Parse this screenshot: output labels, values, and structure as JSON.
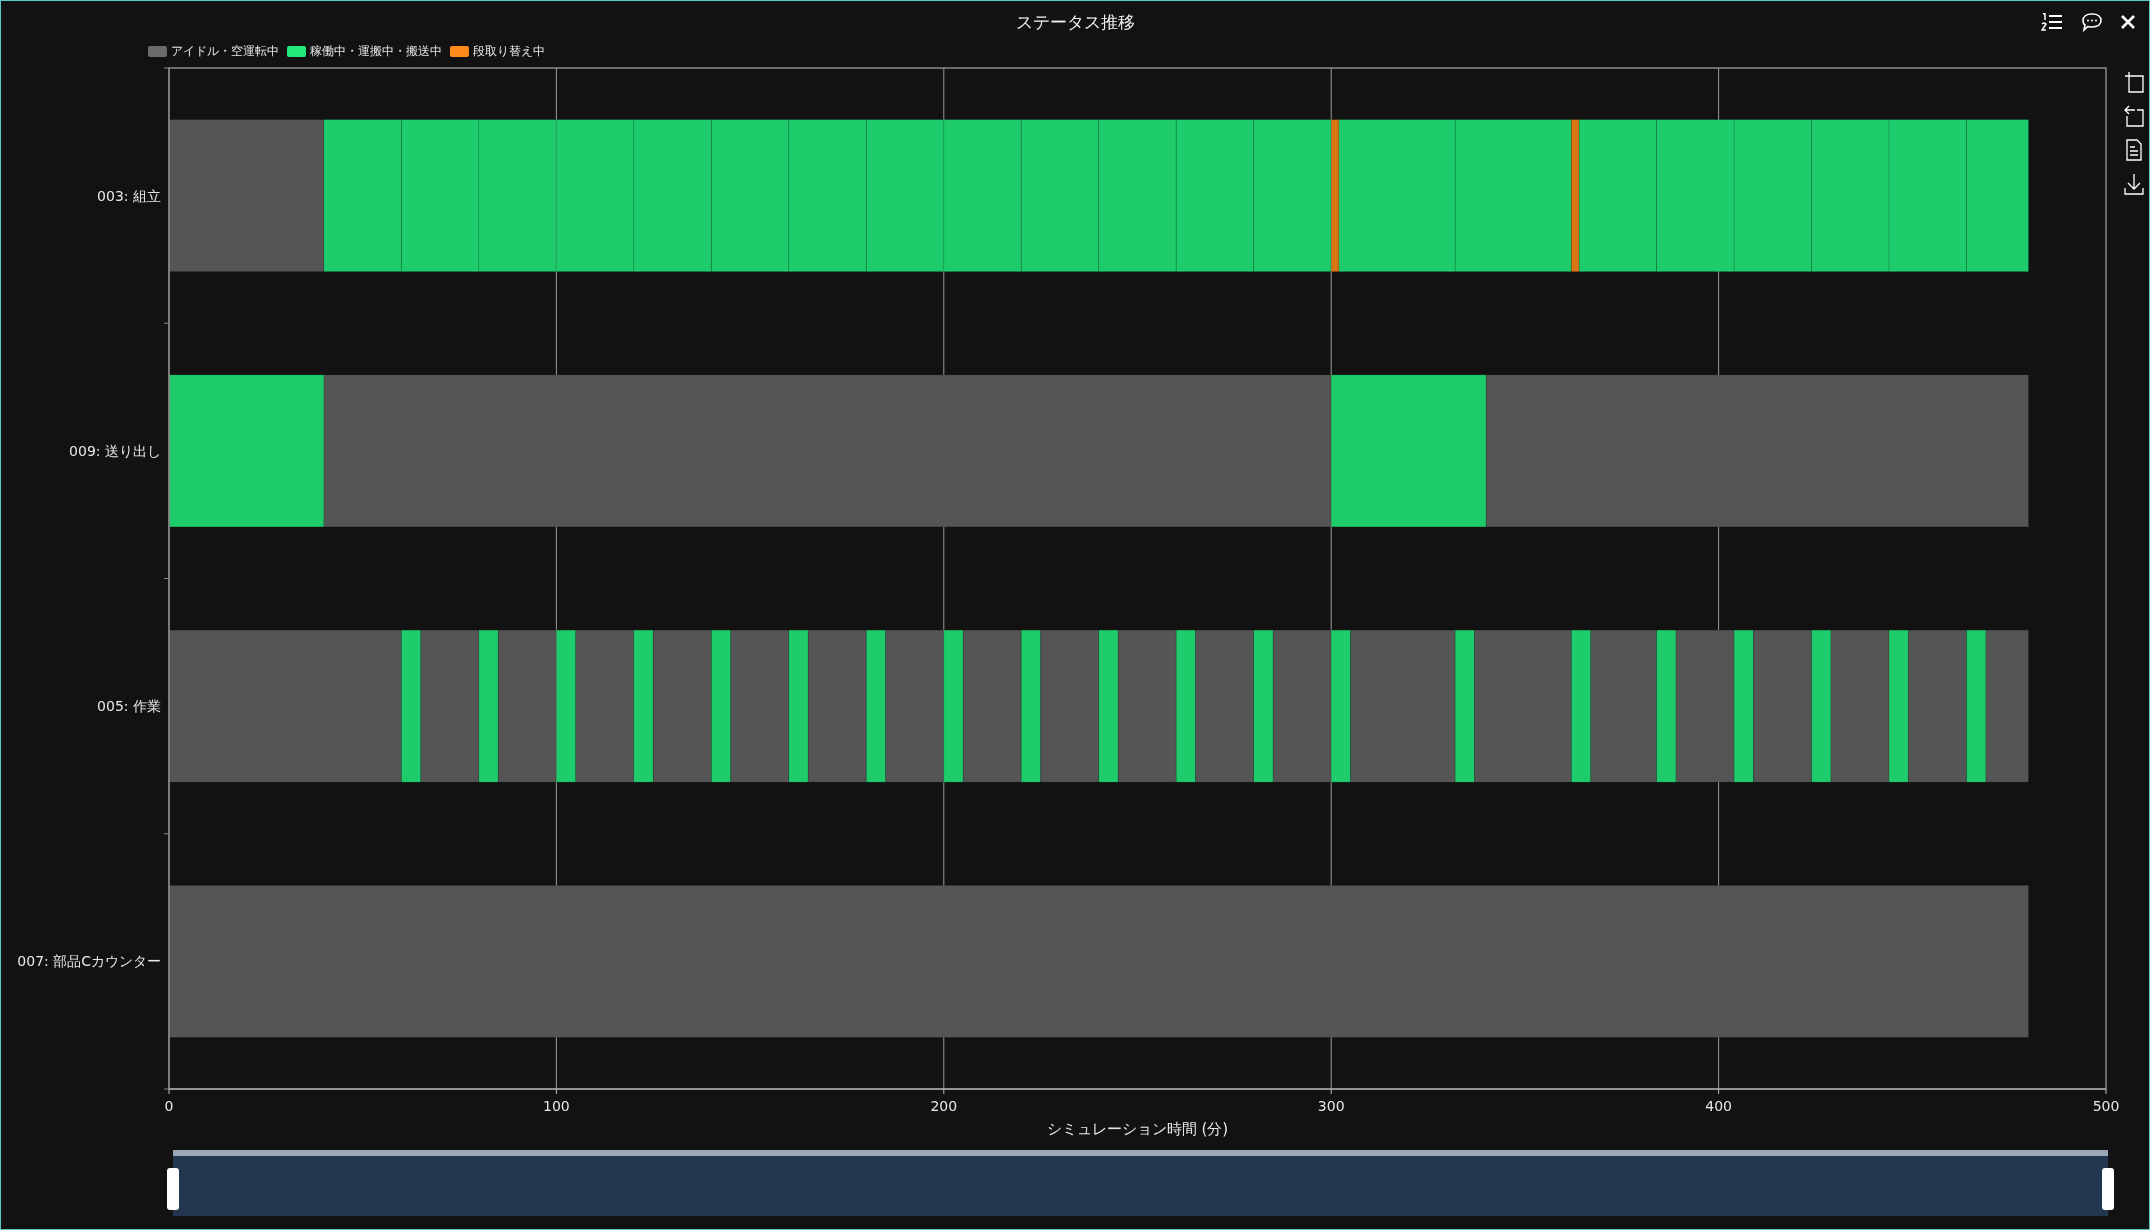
{
  "window": {
    "title": "ステータス推移"
  },
  "chart": {
    "legend": [
      {
        "label": "アイドル・空運転中",
        "color": "#6b6b6b"
      },
      {
        "label": "稼働中・運搬中・搬送中",
        "color": "#25e87a"
      },
      {
        "label": "段取り替え中",
        "color": "#ff8c1a"
      }
    ],
    "chart_data": {
      "type": "bar",
      "orientation": "horizontal",
      "stacked": true,
      "grid": true,
      "xlabel": "シミュレーション時間 (分)",
      "categories": [
        "003: 組立",
        "009: 送り出し",
        "005: 作業",
        "007: 部品Cカウンター"
      ],
      "xlim": [
        0,
        500
      ],
      "xticks": [
        0,
        100,
        200,
        300,
        400,
        500
      ],
      "series": [
        {
          "color": "#555555",
          "values": [
            40,
            null,
            60,
            480
          ]
        },
        {
          "color": "#1ecc6c",
          "values": [
            20,
            40,
            5,
            null
          ]
        },
        {
          "color": "#555555",
          "values": [
            null,
            260,
            15,
            null
          ]
        },
        {
          "color": "#1ecc6c",
          "values": [
            20,
            40,
            5,
            null
          ]
        },
        {
          "color": "#555555",
          "values": [
            null,
            140,
            15,
            null
          ]
        },
        {
          "color": "#1ecc6c",
          "values": [
            20,
            null,
            5,
            null
          ]
        },
        {
          "color": "#555555",
          "values": [
            null,
            null,
            15,
            null
          ]
        },
        {
          "color": "#1ecc6c",
          "values": [
            20,
            null,
            5,
            null
          ]
        },
        {
          "color": "#555555",
          "values": [
            null,
            null,
            15,
            null
          ]
        },
        {
          "color": "#1ecc6c",
          "values": [
            20,
            null,
            5,
            null
          ]
        },
        {
          "color": "#555555",
          "values": [
            null,
            null,
            15,
            null
          ]
        },
        {
          "color": "#1ecc6c",
          "values": [
            20,
            null,
            5,
            null
          ]
        },
        {
          "color": "#555555",
          "values": [
            null,
            null,
            15,
            null
          ]
        },
        {
          "color": "#1ecc6c",
          "values": [
            20,
            null,
            5,
            null
          ]
        },
        {
          "color": "#555555",
          "values": [
            null,
            null,
            15,
            null
          ]
        },
        {
          "color": "#1ecc6c",
          "values": [
            20,
            null,
            5,
            null
          ]
        },
        {
          "color": "#555555",
          "values": [
            null,
            null,
            15,
            null
          ]
        },
        {
          "color": "#1ecc6c",
          "values": [
            20,
            null,
            5,
            null
          ]
        },
        {
          "color": "#555555",
          "values": [
            null,
            null,
            15,
            null
          ]
        },
        {
          "color": "#1ecc6c",
          "values": [
            20,
            null,
            5,
            null
          ]
        },
        {
          "color": "#555555",
          "values": [
            null,
            null,
            15,
            null
          ]
        },
        {
          "color": "#1ecc6c",
          "values": [
            20,
            null,
            5,
            null
          ]
        },
        {
          "color": "#555555",
          "values": [
            null,
            null,
            15,
            null
          ]
        },
        {
          "color": "#1ecc6c",
          "values": [
            20,
            null,
            5,
            null
          ]
        },
        {
          "color": "#555555",
          "values": [
            null,
            null,
            15,
            null
          ]
        },
        {
          "color": "#1ecc6c",
          "values": [
            20,
            null,
            5,
            null
          ]
        },
        {
          "color": "#d87614",
          "values": [
            2,
            null,
            null,
            null
          ]
        },
        {
          "color": "#555555",
          "values": [
            null,
            null,
            27,
            null
          ]
        },
        {
          "color": "#1ecc6c",
          "values": [
            30,
            null,
            5,
            null
          ]
        },
        {
          "color": "#555555",
          "values": [
            null,
            null,
            25,
            null
          ]
        },
        {
          "color": "#1ecc6c",
          "values": [
            30,
            null,
            5,
            null
          ]
        },
        {
          "color": "#d87614",
          "values": [
            2,
            null,
            null,
            null
          ]
        },
        {
          "color": "#555555",
          "values": [
            null,
            null,
            17,
            null
          ]
        },
        {
          "color": "#1ecc6c",
          "values": [
            20,
            null,
            5,
            null
          ]
        },
        {
          "color": "#555555",
          "values": [
            null,
            null,
            15,
            null
          ]
        },
        {
          "color": "#1ecc6c",
          "values": [
            20,
            null,
            5,
            null
          ]
        },
        {
          "color": "#555555",
          "values": [
            null,
            null,
            15,
            null
          ]
        },
        {
          "color": "#1ecc6c",
          "values": [
            20,
            null,
            5,
            null
          ]
        },
        {
          "color": "#555555",
          "values": [
            null,
            null,
            15,
            null
          ]
        },
        {
          "color": "#1ecc6c",
          "values": [
            20,
            null,
            5,
            null
          ]
        },
        {
          "color": "#555555",
          "values": [
            null,
            null,
            15,
            null
          ]
        },
        {
          "color": "#1ecc6c",
          "values": [
            20,
            null,
            5,
            null
          ]
        },
        {
          "color": "#555555",
          "values": [
            null,
            null,
            11,
            null
          ]
        },
        {
          "color": "#1ecc6c",
          "values": [
            16,
            null,
            null,
            null
          ]
        }
      ]
    }
  }
}
